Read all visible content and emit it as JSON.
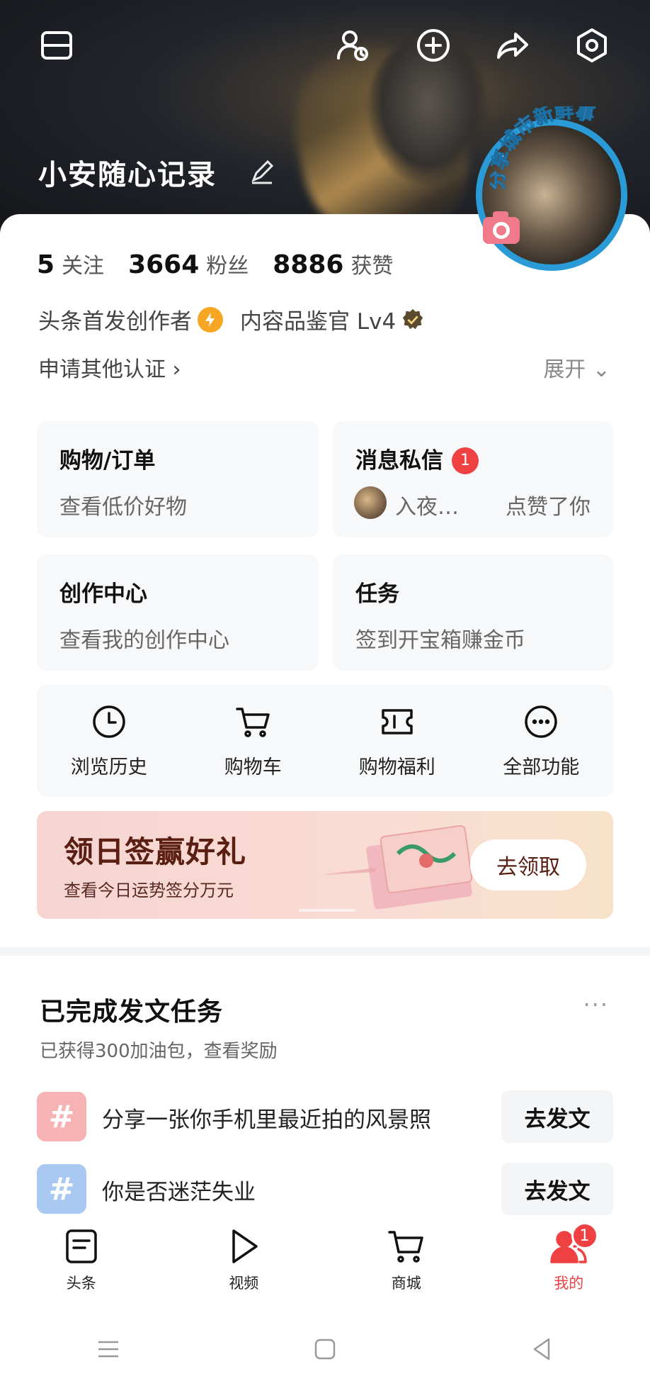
{
  "header": {
    "username": "小安随心记录",
    "icons": [
      "menu-icon",
      "profile-visitors-icon",
      "add-icon",
      "share-icon",
      "settings-icon",
      "edit-icon"
    ],
    "avatar_label": "分享城市新鲜事"
  },
  "stats": [
    {
      "value": "5",
      "label": "关注"
    },
    {
      "value": "3664",
      "label": "粉丝"
    },
    {
      "value": "8886",
      "label": "获赞"
    }
  ],
  "badges": {
    "creator": "头条首发创作者",
    "curator": "内容品鉴官 Lv4"
  },
  "links": {
    "apply": "申请其他认证",
    "expand": "展开"
  },
  "cards": {
    "shopping": {
      "title": "购物/订单",
      "subtitle": "查看低价好物"
    },
    "messages": {
      "title": "消息私信",
      "badge": "1",
      "from": "入夜…",
      "action": "点赞了你"
    },
    "creation": {
      "title": "创作中心",
      "subtitle": "查看我的创作中心"
    },
    "tasks": {
      "title": "任务",
      "subtitle": "签到开宝箱赚金币"
    }
  },
  "tools": [
    {
      "label": "浏览历史",
      "icon": "clock-icon"
    },
    {
      "label": "购物车",
      "icon": "cart-icon"
    },
    {
      "label": "购物福利",
      "icon": "coupon-icon"
    },
    {
      "label": "全部功能",
      "icon": "more-icon"
    }
  ],
  "banner": {
    "title": "领日签赢好礼",
    "subtitle": "查看今日运势签分万元",
    "button": "去领取"
  },
  "task_section": {
    "title": "已完成发文任务",
    "more": "···",
    "subtitle": "已获得300加油包，查看奖励",
    "items": [
      {
        "text": "分享一张你手机里最近拍的风景照",
        "button": "去发文",
        "color": "#f7b3b3"
      },
      {
        "text": "你是否迷茫失业",
        "button": "去发文",
        "color": "#a9c8f2"
      }
    ]
  },
  "bottom_nav": [
    {
      "label": "头条",
      "icon": "news-icon"
    },
    {
      "label": "视频",
      "icon": "play-icon"
    },
    {
      "label": "商城",
      "icon": "cart-icon"
    },
    {
      "label": "我的",
      "icon": "user-icon",
      "badge": "1",
      "active": true
    }
  ],
  "colors": {
    "accent": "#f04142",
    "avatar_ring": "#2a9bd6",
    "bolt": "#f6a623"
  }
}
